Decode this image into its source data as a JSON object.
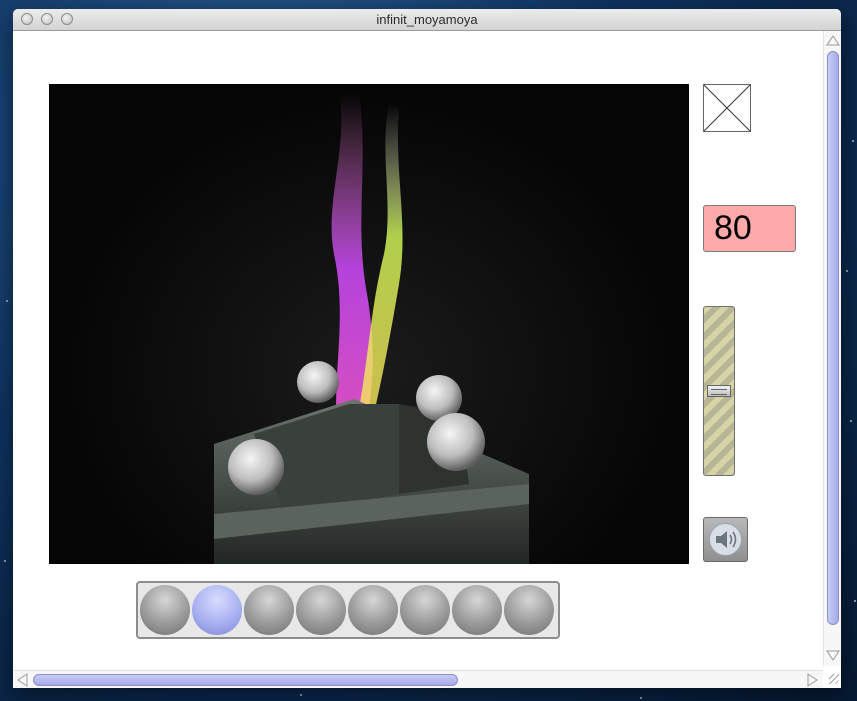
{
  "window": {
    "title": "infinit_moyamoya"
  },
  "video": {
    "description_icon": "video-frame"
  },
  "counter": {
    "value": "80"
  },
  "volume_slider": {
    "level": 0.5
  },
  "sound_button": {
    "icon": "speaker-icon"
  },
  "timeline": {
    "slots": [
      {
        "active": false
      },
      {
        "active": true
      },
      {
        "active": false
      },
      {
        "active": false
      },
      {
        "active": false
      },
      {
        "active": false
      },
      {
        "active": false
      },
      {
        "active": false
      }
    ]
  },
  "scrollbars": {
    "vertical": {
      "position": 0.0,
      "visible_fraction": 0.9
    },
    "horizontal": {
      "position": 0.0,
      "visible_fraction": 0.55
    }
  },
  "colors": {
    "counter_bg": "#ffaaaa",
    "active_slot": "#a8b0f0",
    "scroll_thumb": "#b0b5ec"
  }
}
